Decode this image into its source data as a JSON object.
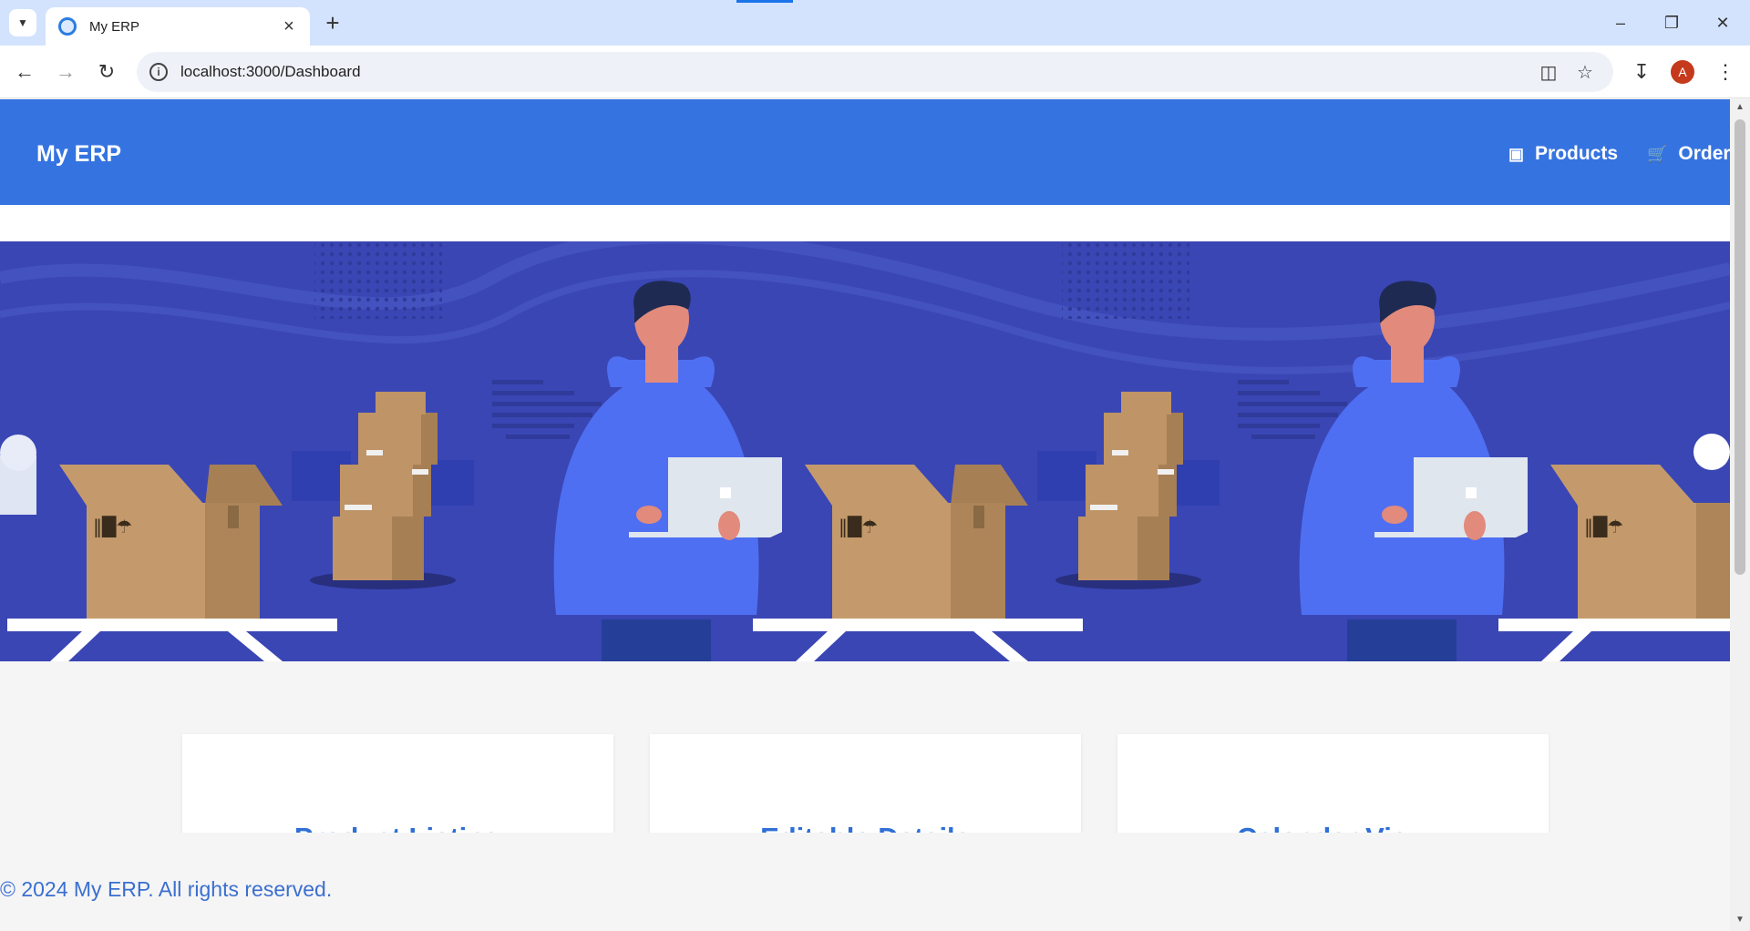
{
  "browser": {
    "tab_title": "My ERP",
    "url": "localhost:3000/Dashboard",
    "profile_initial": "A"
  },
  "app": {
    "brand": "My ERP",
    "nav": [
      {
        "label": "Products",
        "icon": "archive-icon"
      },
      {
        "label": "Orders",
        "icon": "cart-icon"
      }
    ]
  },
  "hero": {
    "illustration": "warehouse-worker-with-laptop-and-boxes",
    "background_color": "#3a46b4"
  },
  "cards": [
    {
      "title": "Product Listing"
    },
    {
      "title": "Editable Details"
    },
    {
      "title": "Calendar View"
    }
  ],
  "footer": {
    "text": "© 2024 My ERP. All rights reserved."
  },
  "colors": {
    "header": "#3574e0",
    "accent_text": "#2f6fd6",
    "page_bg": "#f5f5f5"
  }
}
